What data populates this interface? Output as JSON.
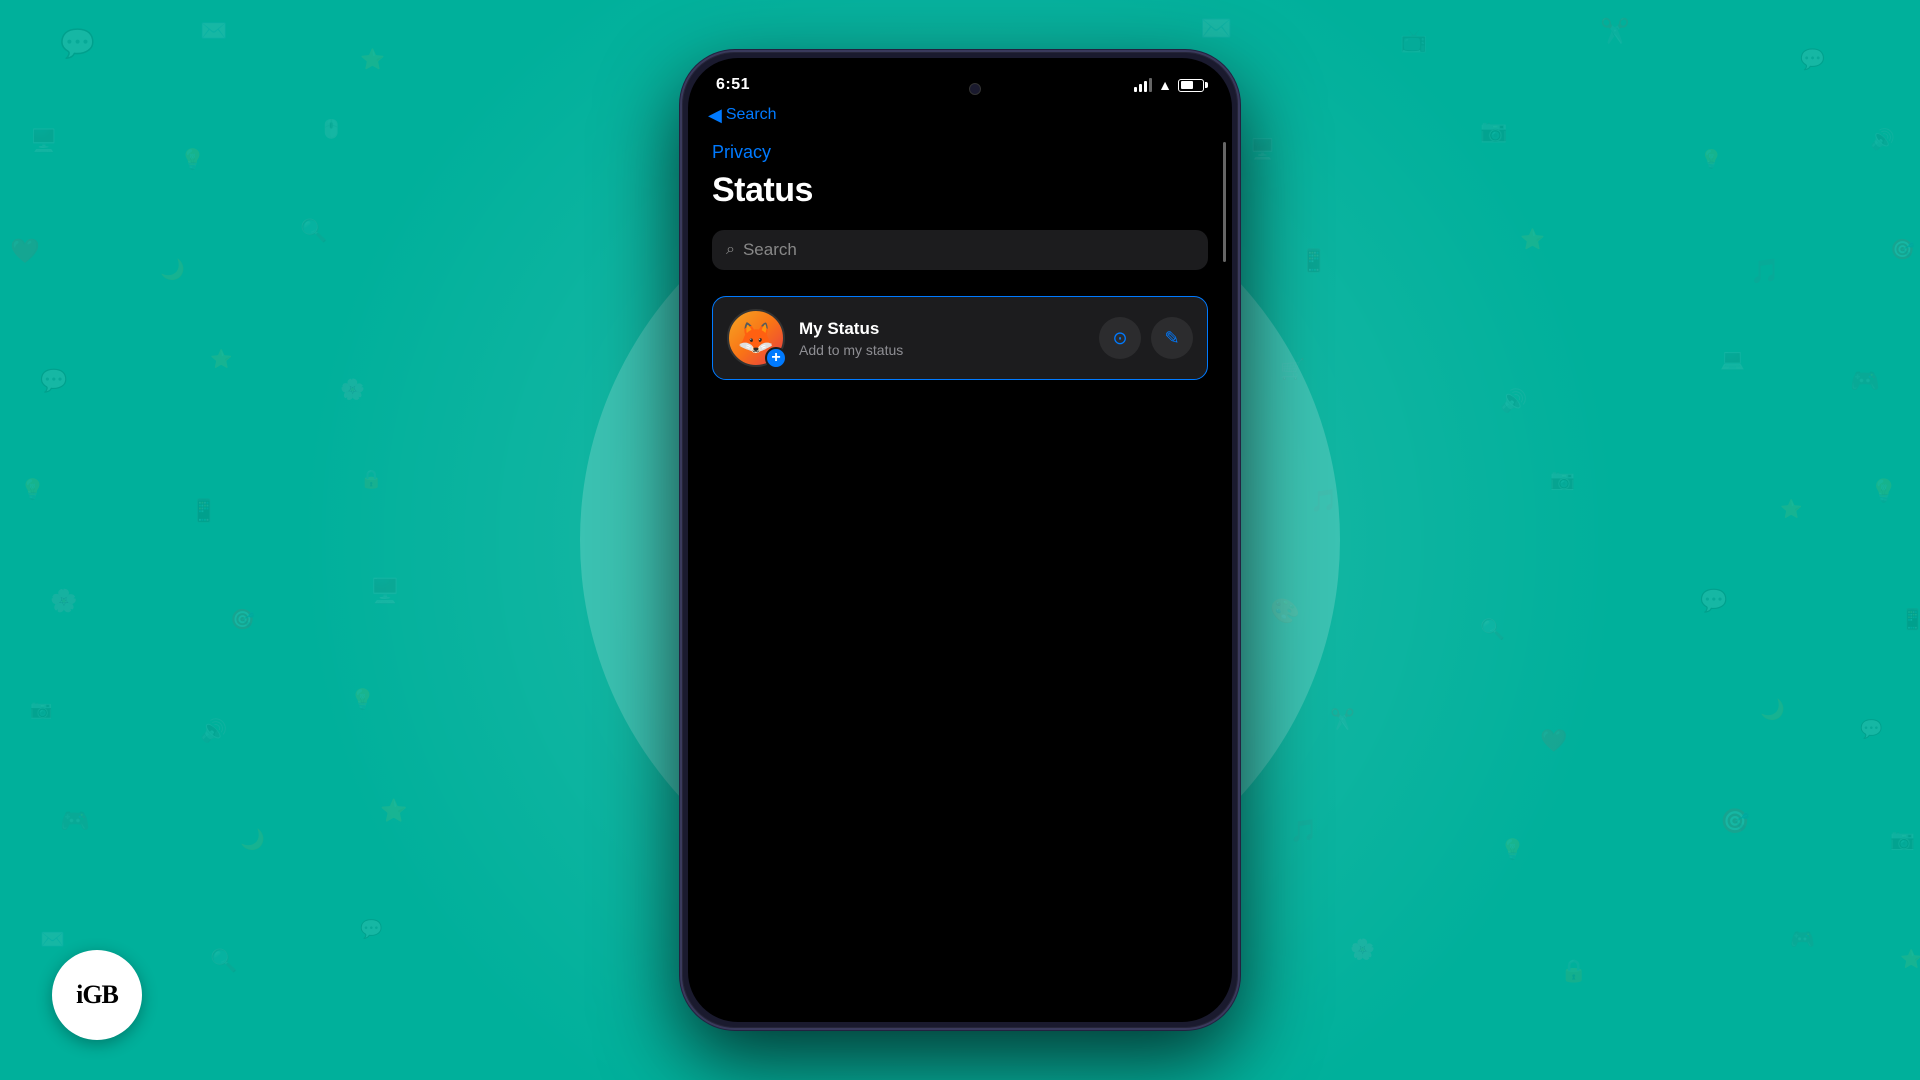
{
  "background": {
    "color": "#00b09b"
  },
  "statusBar": {
    "time": "6:51",
    "backLabel": "Search"
  },
  "navBar": {
    "backText": "Search"
  },
  "screen": {
    "privacyLabel": "Privacy",
    "pageTitle": "Status",
    "search": {
      "placeholder": "Search"
    },
    "myStatus": {
      "name": "My Status",
      "subtitle": "Add to my status",
      "avatarEmoji": "🦊",
      "addBadge": "+",
      "cameraIcon": "📷",
      "pencilIcon": "✏️"
    }
  },
  "igbLogo": "iGB",
  "icons": {
    "backChevron": "◀",
    "searchIcon": "🔍",
    "plus": "+",
    "camera": "⊙",
    "pencil": "✎"
  }
}
